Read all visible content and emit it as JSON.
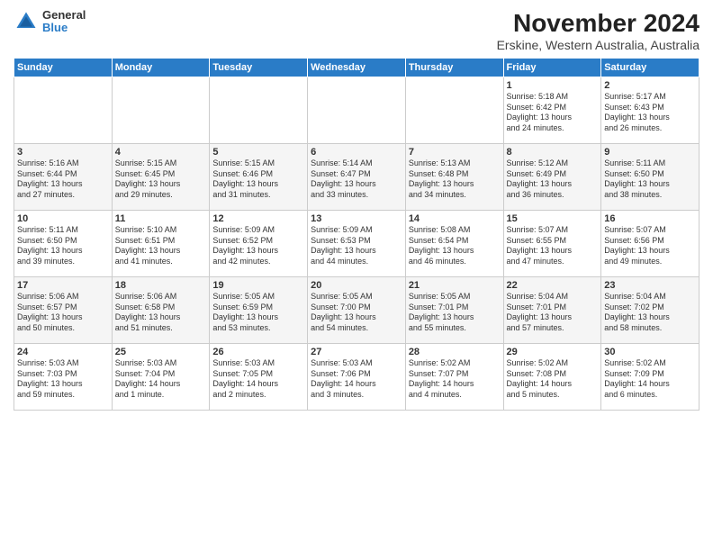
{
  "logo": {
    "line1": "General",
    "line2": "Blue"
  },
  "title": "November 2024",
  "subtitle": "Erskine, Western Australia, Australia",
  "days_of_week": [
    "Sunday",
    "Monday",
    "Tuesday",
    "Wednesday",
    "Thursday",
    "Friday",
    "Saturday"
  ],
  "weeks": [
    [
      {
        "day": "",
        "info": ""
      },
      {
        "day": "",
        "info": ""
      },
      {
        "day": "",
        "info": ""
      },
      {
        "day": "",
        "info": ""
      },
      {
        "day": "",
        "info": ""
      },
      {
        "day": "1",
        "info": "Sunrise: 5:18 AM\nSunset: 6:42 PM\nDaylight: 13 hours\nand 24 minutes."
      },
      {
        "day": "2",
        "info": "Sunrise: 5:17 AM\nSunset: 6:43 PM\nDaylight: 13 hours\nand 26 minutes."
      }
    ],
    [
      {
        "day": "3",
        "info": "Sunrise: 5:16 AM\nSunset: 6:44 PM\nDaylight: 13 hours\nand 27 minutes."
      },
      {
        "day": "4",
        "info": "Sunrise: 5:15 AM\nSunset: 6:45 PM\nDaylight: 13 hours\nand 29 minutes."
      },
      {
        "day": "5",
        "info": "Sunrise: 5:15 AM\nSunset: 6:46 PM\nDaylight: 13 hours\nand 31 minutes."
      },
      {
        "day": "6",
        "info": "Sunrise: 5:14 AM\nSunset: 6:47 PM\nDaylight: 13 hours\nand 33 minutes."
      },
      {
        "day": "7",
        "info": "Sunrise: 5:13 AM\nSunset: 6:48 PM\nDaylight: 13 hours\nand 34 minutes."
      },
      {
        "day": "8",
        "info": "Sunrise: 5:12 AM\nSunset: 6:49 PM\nDaylight: 13 hours\nand 36 minutes."
      },
      {
        "day": "9",
        "info": "Sunrise: 5:11 AM\nSunset: 6:50 PM\nDaylight: 13 hours\nand 38 minutes."
      }
    ],
    [
      {
        "day": "10",
        "info": "Sunrise: 5:11 AM\nSunset: 6:50 PM\nDaylight: 13 hours\nand 39 minutes."
      },
      {
        "day": "11",
        "info": "Sunrise: 5:10 AM\nSunset: 6:51 PM\nDaylight: 13 hours\nand 41 minutes."
      },
      {
        "day": "12",
        "info": "Sunrise: 5:09 AM\nSunset: 6:52 PM\nDaylight: 13 hours\nand 42 minutes."
      },
      {
        "day": "13",
        "info": "Sunrise: 5:09 AM\nSunset: 6:53 PM\nDaylight: 13 hours\nand 44 minutes."
      },
      {
        "day": "14",
        "info": "Sunrise: 5:08 AM\nSunset: 6:54 PM\nDaylight: 13 hours\nand 46 minutes."
      },
      {
        "day": "15",
        "info": "Sunrise: 5:07 AM\nSunset: 6:55 PM\nDaylight: 13 hours\nand 47 minutes."
      },
      {
        "day": "16",
        "info": "Sunrise: 5:07 AM\nSunset: 6:56 PM\nDaylight: 13 hours\nand 49 minutes."
      }
    ],
    [
      {
        "day": "17",
        "info": "Sunrise: 5:06 AM\nSunset: 6:57 PM\nDaylight: 13 hours\nand 50 minutes."
      },
      {
        "day": "18",
        "info": "Sunrise: 5:06 AM\nSunset: 6:58 PM\nDaylight: 13 hours\nand 51 minutes."
      },
      {
        "day": "19",
        "info": "Sunrise: 5:05 AM\nSunset: 6:59 PM\nDaylight: 13 hours\nand 53 minutes."
      },
      {
        "day": "20",
        "info": "Sunrise: 5:05 AM\nSunset: 7:00 PM\nDaylight: 13 hours\nand 54 minutes."
      },
      {
        "day": "21",
        "info": "Sunrise: 5:05 AM\nSunset: 7:01 PM\nDaylight: 13 hours\nand 55 minutes."
      },
      {
        "day": "22",
        "info": "Sunrise: 5:04 AM\nSunset: 7:01 PM\nDaylight: 13 hours\nand 57 minutes."
      },
      {
        "day": "23",
        "info": "Sunrise: 5:04 AM\nSunset: 7:02 PM\nDaylight: 13 hours\nand 58 minutes."
      }
    ],
    [
      {
        "day": "24",
        "info": "Sunrise: 5:03 AM\nSunset: 7:03 PM\nDaylight: 13 hours\nand 59 minutes."
      },
      {
        "day": "25",
        "info": "Sunrise: 5:03 AM\nSunset: 7:04 PM\nDaylight: 14 hours\nand 1 minute."
      },
      {
        "day": "26",
        "info": "Sunrise: 5:03 AM\nSunset: 7:05 PM\nDaylight: 14 hours\nand 2 minutes."
      },
      {
        "day": "27",
        "info": "Sunrise: 5:03 AM\nSunset: 7:06 PM\nDaylight: 14 hours\nand 3 minutes."
      },
      {
        "day": "28",
        "info": "Sunrise: 5:02 AM\nSunset: 7:07 PM\nDaylight: 14 hours\nand 4 minutes."
      },
      {
        "day": "29",
        "info": "Sunrise: 5:02 AM\nSunset: 7:08 PM\nDaylight: 14 hours\nand 5 minutes."
      },
      {
        "day": "30",
        "info": "Sunrise: 5:02 AM\nSunset: 7:09 PM\nDaylight: 14 hours\nand 6 minutes."
      }
    ]
  ]
}
